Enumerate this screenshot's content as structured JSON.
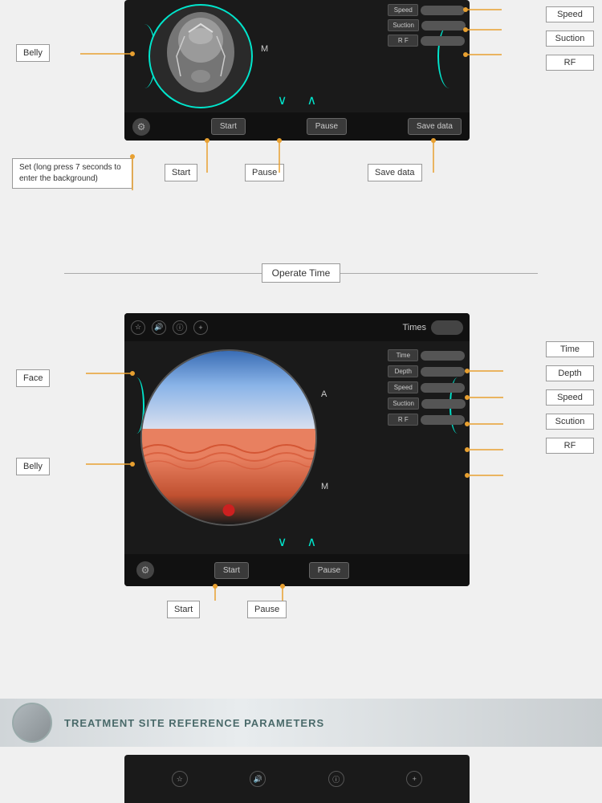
{
  "top_section": {
    "belly_label": "Belly",
    "m_label": "M",
    "controls": {
      "speed_btn": "Speed",
      "suction_btn": "Suction",
      "rf_btn": "R F"
    },
    "bottom_bar": {
      "start_btn": "Start",
      "pause_btn": "Pause",
      "save_btn": "Save data"
    }
  },
  "top_annotations": {
    "speed_label": "Speed",
    "suction_label": "Suction",
    "rf_label": "RF",
    "set_label": "Set (long press 7 seconds to enter the background)",
    "start_label": "Start",
    "pause_label": "Pause",
    "save_label": "Save data"
  },
  "divider": {
    "label": "Operate Time"
  },
  "bottom_section": {
    "face_label": "Face",
    "belly_label": "Belly",
    "a_label": "A",
    "m_label": "M",
    "top_bar": {
      "times_label": "Times"
    },
    "controls": {
      "time_btn": "Time",
      "depth_btn": "Depth",
      "speed_btn": "Speed",
      "suction_btn": "Suction",
      "rf_btn": "R F"
    },
    "bottom_bar": {
      "start_btn": "Start",
      "pause_btn": "Pause"
    }
  },
  "bottom_annotations": {
    "time_label": "Time",
    "depth_label": "Depth",
    "speed_label": "Speed",
    "scution_label": "Scution",
    "rf_label": "RF",
    "start_label": "Start",
    "pause_label": "Pause"
  },
  "treatment_banner": {
    "text": "TREATMENT SITE REFERENCE PARAMETERS"
  },
  "icons": {
    "star": "☆",
    "speaker": "🔊",
    "info": "ⓘ",
    "plus": "+",
    "gear": "⚙",
    "chevron_down": "∨",
    "chevron_up": "∧"
  }
}
